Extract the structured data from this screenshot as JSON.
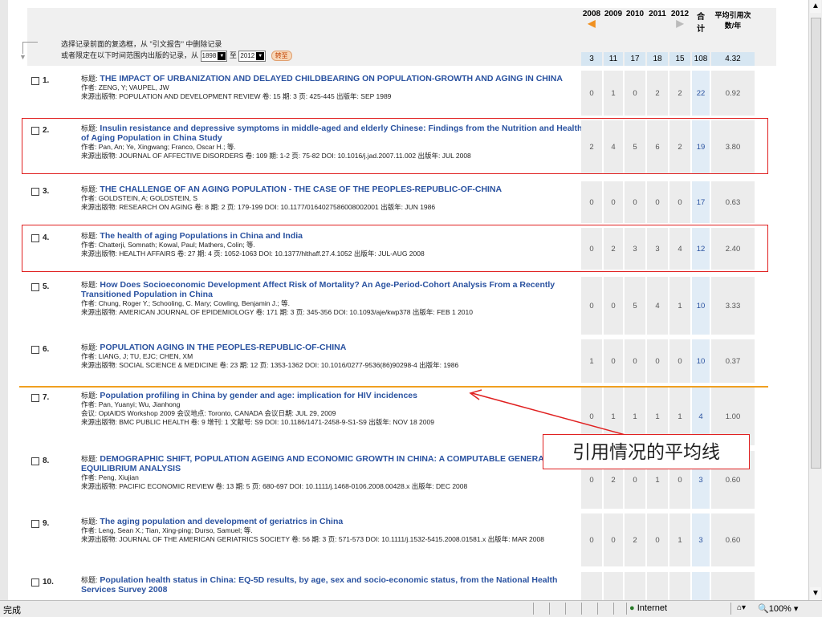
{
  "header": {
    "instruction_line1": "选择记录前面的复选框，从 \"引文报告\" 中删除记录",
    "instruction_line2": "或者限定在以下时间范围内出版的记录，从",
    "from_year": "1898",
    "to_label": "至",
    "to_year": "2012",
    "goto_label": "转至",
    "years": [
      "2008",
      "2009",
      "2010",
      "2011",
      "2012"
    ],
    "total_label": "合计",
    "avg_label": "平均引用次数/年",
    "year_totals": [
      "3",
      "11",
      "17",
      "18",
      "15"
    ],
    "grand_total": "108",
    "avg_total": "4.32"
  },
  "labels": {
    "title": "标题:",
    "author": "作者:",
    "source": "来源出版物:",
    "conference": "会议:"
  },
  "records": [
    {
      "num": "1.",
      "title": "THE IMPACT OF URBANIZATION AND DELAYED CHILDBEARING ON POPULATION-GROWTH AND AGING IN CHINA",
      "authors": "ZENG, Y; VAUPEL, JW",
      "source": "POPULATION AND DEVELOPMENT REVIEW 卷: 15 期: 3 页: 425-445 出版年: SEP 1989",
      "cites": [
        "0",
        "1",
        "0",
        "2",
        "2"
      ],
      "total": "22",
      "avg": "0.92"
    },
    {
      "num": "2.",
      "title": "Insulin resistance and depressive symptoms in middle-aged and elderly Chinese: Findings from the Nutrition and Health of Aging Population in China Study",
      "authors": "Pan, An; Ye, Xingwang; Franco, Oscar H.; 等.",
      "source": "JOURNAL OF AFFECTIVE DISORDERS 卷: 109 期: 1-2 页: 75-82 DOI: 10.1016/j.jad.2007.11.002 出版年: JUL 2008",
      "cites": [
        "2",
        "4",
        "5",
        "6",
        "2"
      ],
      "total": "19",
      "avg": "3.80"
    },
    {
      "num": "3.",
      "title": "THE CHALLENGE OF AN AGING POPULATION - THE CASE OF THE PEOPLES-REPUBLIC-OF-CHINA",
      "authors": "GOLDSTEIN, A; GOLDSTEIN, S",
      "source": "RESEARCH ON AGING 卷: 8 期: 2 页: 179-199 DOI: 10.1177/0164027586008002001 出版年: JUN 1986",
      "cites": [
        "0",
        "0",
        "0",
        "0",
        "0"
      ],
      "total": "17",
      "avg": "0.63"
    },
    {
      "num": "4.",
      "title": "The health of aging Populations in China and India",
      "authors": "Chatterji, Somnath; Kowal, Paul; Mathers, Colin; 等.",
      "source": "HEALTH AFFAIRS 卷: 27 期: 4 页: 1052-1063 DOI: 10.1377/hlthaff.27.4.1052 出版年: JUL-AUG 2008",
      "cites": [
        "0",
        "2",
        "3",
        "3",
        "4"
      ],
      "total": "12",
      "avg": "2.40"
    },
    {
      "num": "5.",
      "title": "How Does Socioeconomic Development Affect Risk of Mortality? An Age-Period-Cohort Analysis From a Recently Transitioned Population in China",
      "authors": "Chung, Roger Y.; Schooling, C. Mary; Cowling, Benjamin J.; 等.",
      "source": "AMERICAN JOURNAL OF EPIDEMIOLOGY 卷: 171 期: 3 页: 345-356 DOI: 10.1093/aje/kwp378 出版年: FEB 1 2010",
      "cites": [
        "0",
        "0",
        "5",
        "4",
        "1"
      ],
      "total": "10",
      "avg": "3.33"
    },
    {
      "num": "6.",
      "title": "POPULATION AGING IN THE PEOPLES-REPUBLIC-OF-CHINA",
      "authors": "LIANG, J; TU, EJC; CHEN, XM",
      "source": "SOCIAL SCIENCE & MEDICINE 卷: 23 期: 12 页: 1353-1362 DOI: 10.1016/0277-9536(86)90298-4 出版年: 1986",
      "cites": [
        "1",
        "0",
        "0",
        "0",
        "0"
      ],
      "total": "10",
      "avg": "0.37"
    },
    {
      "num": "7.",
      "title": "Population profiling in China by gender and age: implication for HIV incidences",
      "authors": "Pan, Yuanyi; Wu, Jianhong",
      "conference": "OptAIDS Workshop 2009 会议地点: Toronto, CANADA 会议日期: JUL 29, 2009",
      "source": "BMC PUBLIC HEALTH 卷: 9 增刊: 1 文献号: S9 DOI: 10.1186/1471-2458-9-S1-S9 出版年: NOV 18 2009",
      "cites": [
        "0",
        "1",
        "1",
        "1",
        "1"
      ],
      "total": "4",
      "avg": "1.00"
    },
    {
      "num": "8.",
      "title": "DEMOGRAPHIC SHIFT, POPULATION AGEING AND ECONOMIC GROWTH IN CHINA: A COMPUTABLE GENERAL EQUILIBRIUM ANALYSIS",
      "authors": "Peng, Xiujian",
      "source": "PACIFIC ECONOMIC REVIEW 卷: 13 期: 5 页: 680-697 DOI: 10.1111/j.1468-0106.2008.00428.x 出版年: DEC 2008",
      "cites": [
        "0",
        "2",
        "0",
        "1",
        "0"
      ],
      "total": "3",
      "avg": "0.60"
    },
    {
      "num": "9.",
      "title": "The aging population and development of geriatrics in China",
      "authors": "Leng, Sean X.; Tian, Xing-ping; Durso, Samuel; 等.",
      "source": "JOURNAL OF THE AMERICAN GERIATRICS SOCIETY 卷: 56 期: 3 页: 571-573 DOI: 10.1111/j.1532-5415.2008.01581.x 出版年: MAR 2008",
      "cites": [
        "0",
        "0",
        "2",
        "0",
        "1"
      ],
      "total": "3",
      "avg": "0.60"
    },
    {
      "num": "10.",
      "title": "Population health status in China: EQ-5D results, by age, sex and socio-economic status, from the National Health Services Survey 2008",
      "authors": "",
      "source": "",
      "cites": [
        "",
        "",
        "",
        "",
        ""
      ],
      "total": "",
      "avg": ""
    }
  ],
  "annotation": {
    "callout_text": "引用情况的平均线"
  },
  "statusbar": {
    "done": "完成",
    "zone": "Internet",
    "zoom": "100%"
  }
}
